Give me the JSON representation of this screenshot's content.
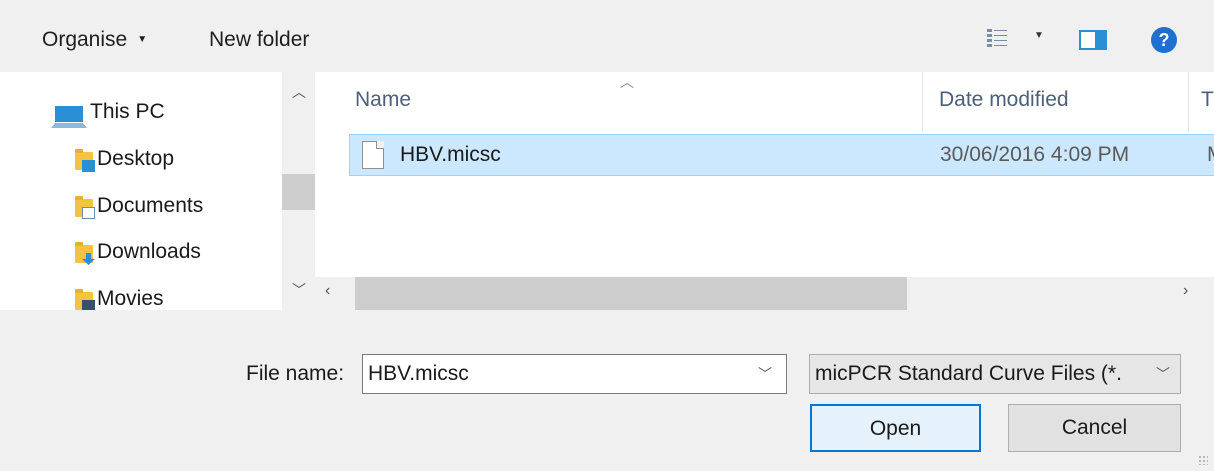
{
  "toolbar": {
    "organise_label": "Organise",
    "new_folder_label": "New folder",
    "help_symbol": "?"
  },
  "nav": {
    "items": [
      {
        "label": "This PC",
        "icon": "computer-icon"
      },
      {
        "label": "Desktop",
        "icon": "desktop-folder-icon"
      },
      {
        "label": "Documents",
        "icon": "documents-folder-icon"
      },
      {
        "label": "Downloads",
        "icon": "downloads-folder-icon"
      },
      {
        "label": "Movies",
        "icon": "movies-folder-icon"
      }
    ]
  },
  "filelist": {
    "columns": [
      "Name",
      "Date modified",
      "T"
    ],
    "rows": [
      {
        "name": "HBV.micsc",
        "date": "30/06/2016 4:09 PM",
        "type": "M"
      }
    ]
  },
  "bottom": {
    "file_name_label": "File name:",
    "file_name_value": "HBV.micsc",
    "file_type_value": "micPCR Standard Curve Files (*.",
    "open_label": "Open",
    "cancel_label": "Cancel"
  },
  "colors": {
    "selection_bg": "#cce8ff",
    "accent": "#0078d7"
  }
}
